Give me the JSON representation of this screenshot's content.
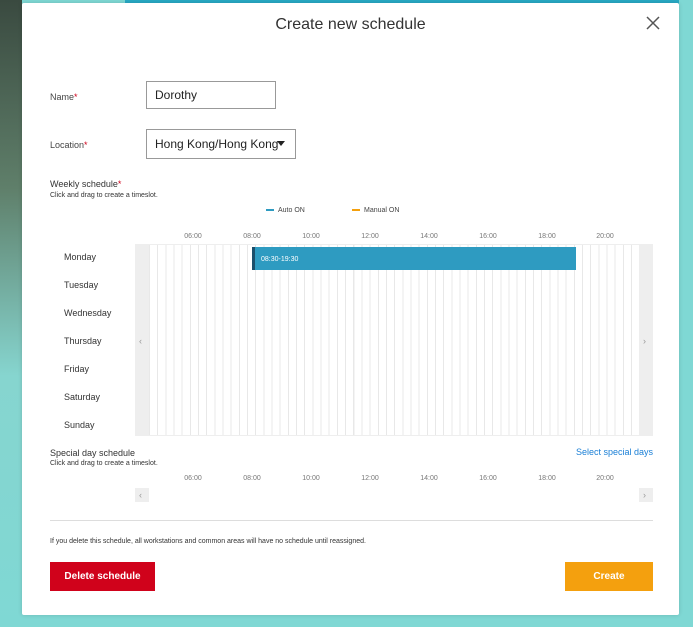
{
  "modal": {
    "title": "Create new schedule",
    "name_label": "Name",
    "name_value": "Dorothy",
    "location_label": "Location",
    "location_value": "Hong Kong/Hong Kong",
    "required_mark": "*"
  },
  "weekly": {
    "title": "Weekly schedule",
    "hint": "Click and drag to create a timeslot.",
    "legend": [
      {
        "label": "Auto ON",
        "color": "#2e9bc1"
      },
      {
        "label": "Manual ON",
        "color": "#f4a00e"
      }
    ],
    "times": [
      "06:00",
      "08:00",
      "10:00",
      "12:00",
      "14:00",
      "16:00",
      "18:00",
      "20:00"
    ],
    "days": [
      "Monday",
      "Tuesday",
      "Wednesday",
      "Thursday",
      "Friday",
      "Saturday",
      "Sunday"
    ],
    "slot_label": "08:30-19:30",
    "left_arrow": "‹",
    "right_arrow": "›"
  },
  "special": {
    "title": "Special day schedule",
    "hint": "Click and drag to create a timeslot.",
    "link": "Select special days",
    "times": [
      "06:00",
      "08:00",
      "10:00",
      "12:00",
      "14:00",
      "16:00",
      "18:00",
      "20:00"
    ],
    "left_arrow": "‹",
    "right_arrow": "›"
  },
  "footer": {
    "warning": "If you delete this schedule, all workstations and common areas will have no schedule until reassigned.",
    "delete_label": "Delete schedule",
    "create_label": "Create"
  },
  "colors": {
    "auto_on": "#2e9bc1",
    "manual_on": "#f4a00e",
    "delete": "#d0021b",
    "create": "#f4a00e",
    "link": "#1a7fd6"
  }
}
